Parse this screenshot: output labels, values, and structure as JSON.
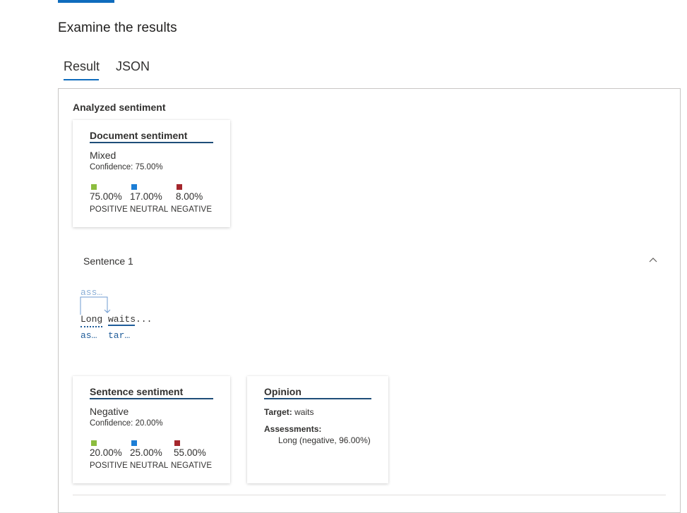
{
  "header": {
    "title": "Examine the results"
  },
  "tabs": [
    {
      "label": "Result",
      "active": true
    },
    {
      "label": "JSON",
      "active": false
    }
  ],
  "panel": {
    "heading": "Analyzed sentiment",
    "document_sentiment": {
      "title": "Document sentiment",
      "label": "Mixed",
      "confidence": "Confidence: 75.00%",
      "scores": [
        {
          "percent": "75.00%",
          "category": "POSITIVE",
          "color": "#8cbd3f"
        },
        {
          "percent": "17.00%",
          "category": "NEUTRAL",
          "color": "#1c7ed6"
        },
        {
          "percent": "8.00%",
          "category": "NEGATIVE",
          "color": "#a4262c"
        }
      ]
    },
    "sentence": {
      "label": "Sentence 1",
      "collapse_icon": "chevron-up-icon",
      "annotation": {
        "top_label": "ass…",
        "text_word1": "Long",
        "text_word2": "waits",
        "text_ellipsis": "...",
        "bottom_label1": "as…",
        "bottom_label2": "tar…"
      },
      "sentence_sentiment": {
        "title": "Sentence sentiment",
        "label": "Negative",
        "confidence": "Confidence: 20.00%",
        "scores": [
          {
            "percent": "20.00%",
            "category": "POSITIVE",
            "color": "#8cbd3f"
          },
          {
            "percent": "25.00%",
            "category": "NEUTRAL",
            "color": "#1c7ed6"
          },
          {
            "percent": "55.00%",
            "category": "NEGATIVE",
            "color": "#a4262c"
          }
        ]
      },
      "opinion": {
        "title": "Opinion",
        "target_key": "Target:",
        "target_value": "waits",
        "assessments_key": "Assessments:",
        "assessment_value": "Long (negative, 96.00%)"
      }
    }
  },
  "colors": {
    "accent": "#0f6cbd",
    "title_underline": "#1f4e79",
    "annotation_blue": "#1f5c99"
  }
}
